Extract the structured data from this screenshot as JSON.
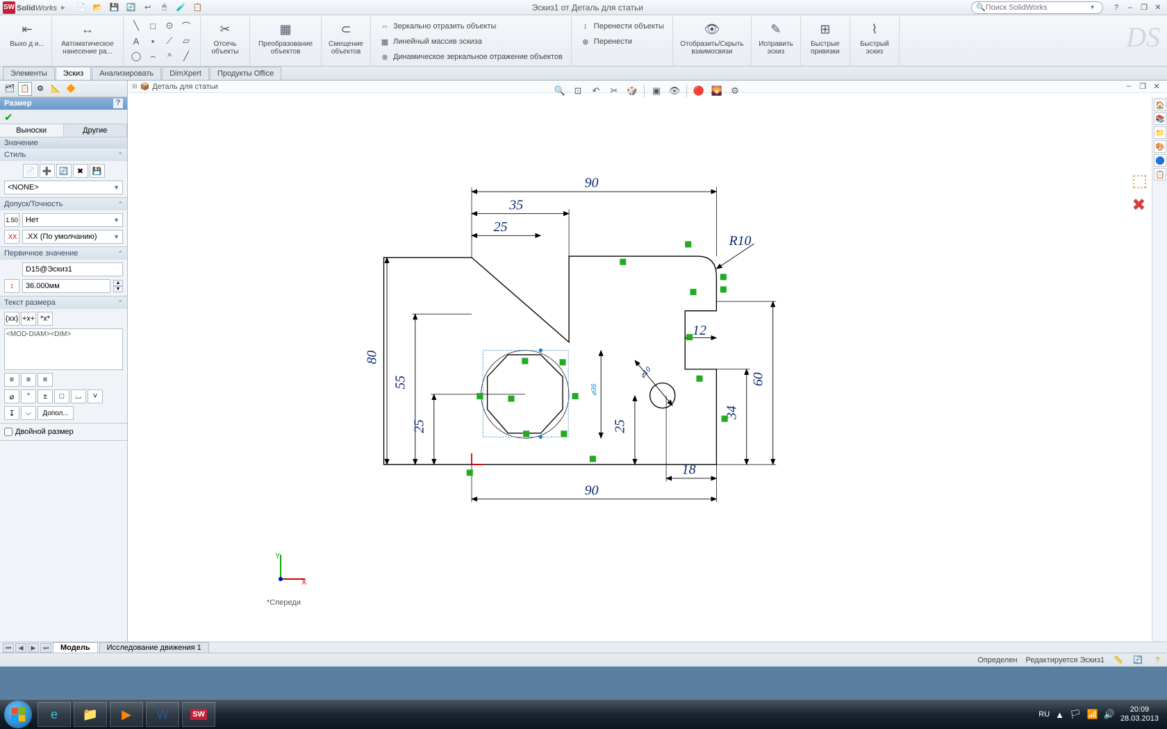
{
  "app": {
    "name_bold": "Solid",
    "name_ital": "Works"
  },
  "qat_icons": [
    "📄",
    "📂",
    "💾",
    "🔄",
    "↩",
    "🖱",
    "🧪",
    "📋"
  ],
  "doc_title": "Эскиз1 от Деталь для статьи",
  "search_placeholder": "Поиск SolidWorks",
  "win": {
    "help": "?",
    "min": "–",
    "max": "❐",
    "close": "✕"
  },
  "ribbon": {
    "big": [
      {
        "icon": "⇤",
        "label": "Выхо\nд и..."
      },
      {
        "icon": "↔",
        "label": "Автоматическое\nнанесение ра..."
      }
    ],
    "tools_grid": [
      "╲",
      "□",
      "⊙",
      "⌒",
      "A",
      "•",
      "⟋",
      "▱",
      "◯",
      "⌢",
      "^",
      "╱"
    ],
    "big2": [
      {
        "icon": "✂",
        "label": "Отсечь\nобъекты"
      },
      {
        "icon": "▦",
        "label": "Преобразование\nобъектов"
      },
      {
        "icon": "⊂",
        "label": "Смещение\nобъектов"
      }
    ],
    "rows1": [
      {
        "icon": "⇔",
        "text": "Зеркально отразить объекты"
      },
      {
        "icon": "▦",
        "text": "Линейный массив эскиза"
      },
      {
        "icon": "⊕",
        "text": "Перенести"
      }
    ],
    "rows2": [
      {
        "icon": "↕",
        "text": "Перенести объекты"
      },
      {
        "icon": "",
        "text": ""
      },
      {
        "icon": "⊗",
        "text": "Динамическое зеркальное отражение объектов"
      }
    ],
    "big3": [
      {
        "icon": "👁",
        "label": "Отобразить/Скрыть\nвзаимосвязи"
      },
      {
        "icon": "✎",
        "label": "Исправить\nэскиз"
      },
      {
        "icon": "⊞",
        "label": "Быстрые\nпривязки"
      },
      {
        "icon": "⌇",
        "label": "Быстрый\nэскиз"
      }
    ]
  },
  "tabs": [
    "Элементы",
    "Эскиз",
    "Анализировать",
    "DimXpert",
    "Продукты Office"
  ],
  "active_tab": 1,
  "pm": {
    "header": "Размер",
    "subtabs": [
      "Выноски",
      "Другие"
    ],
    "value_hdr": "Значение",
    "sect_style": "Стиль",
    "style_none": "<NONE>",
    "sect_tol": "Допуск/Точность",
    "tol_dd1": "Нет",
    "tol_dd2": ".XX (По умолчанию)",
    "sect_prim": "Первичное значение",
    "prim_name": "D15@Эскиз1",
    "prim_val": "36.000мм",
    "sect_dimtext": "Текст размера",
    "dimtext_val": "<MOD-DIAM><DIM>",
    "more_btn": "Допол...",
    "dual": "Двойной размер"
  },
  "tree_item": "Деталь для статьи",
  "view_label": "*Спереди",
  "dims": {
    "d90_top": "90",
    "d35": "35",
    "d25_top": "25",
    "d80": "80",
    "d55": "55",
    "d25_l": "25",
    "d36": "36",
    "d10": "10",
    "d12": "12",
    "d60": "60",
    "d34": "34",
    "d25_r": "25",
    "d18": "18",
    "d90_bot": "90",
    "r10": "R10"
  },
  "bot_tabs": [
    "Модель",
    "Исследование движения 1"
  ],
  "status": {
    "defined": "Определен",
    "editing": "Редактируется Эскиз1"
  },
  "tray": {
    "lang": "RU",
    "time": "20:09",
    "date": "28.03.2013"
  }
}
